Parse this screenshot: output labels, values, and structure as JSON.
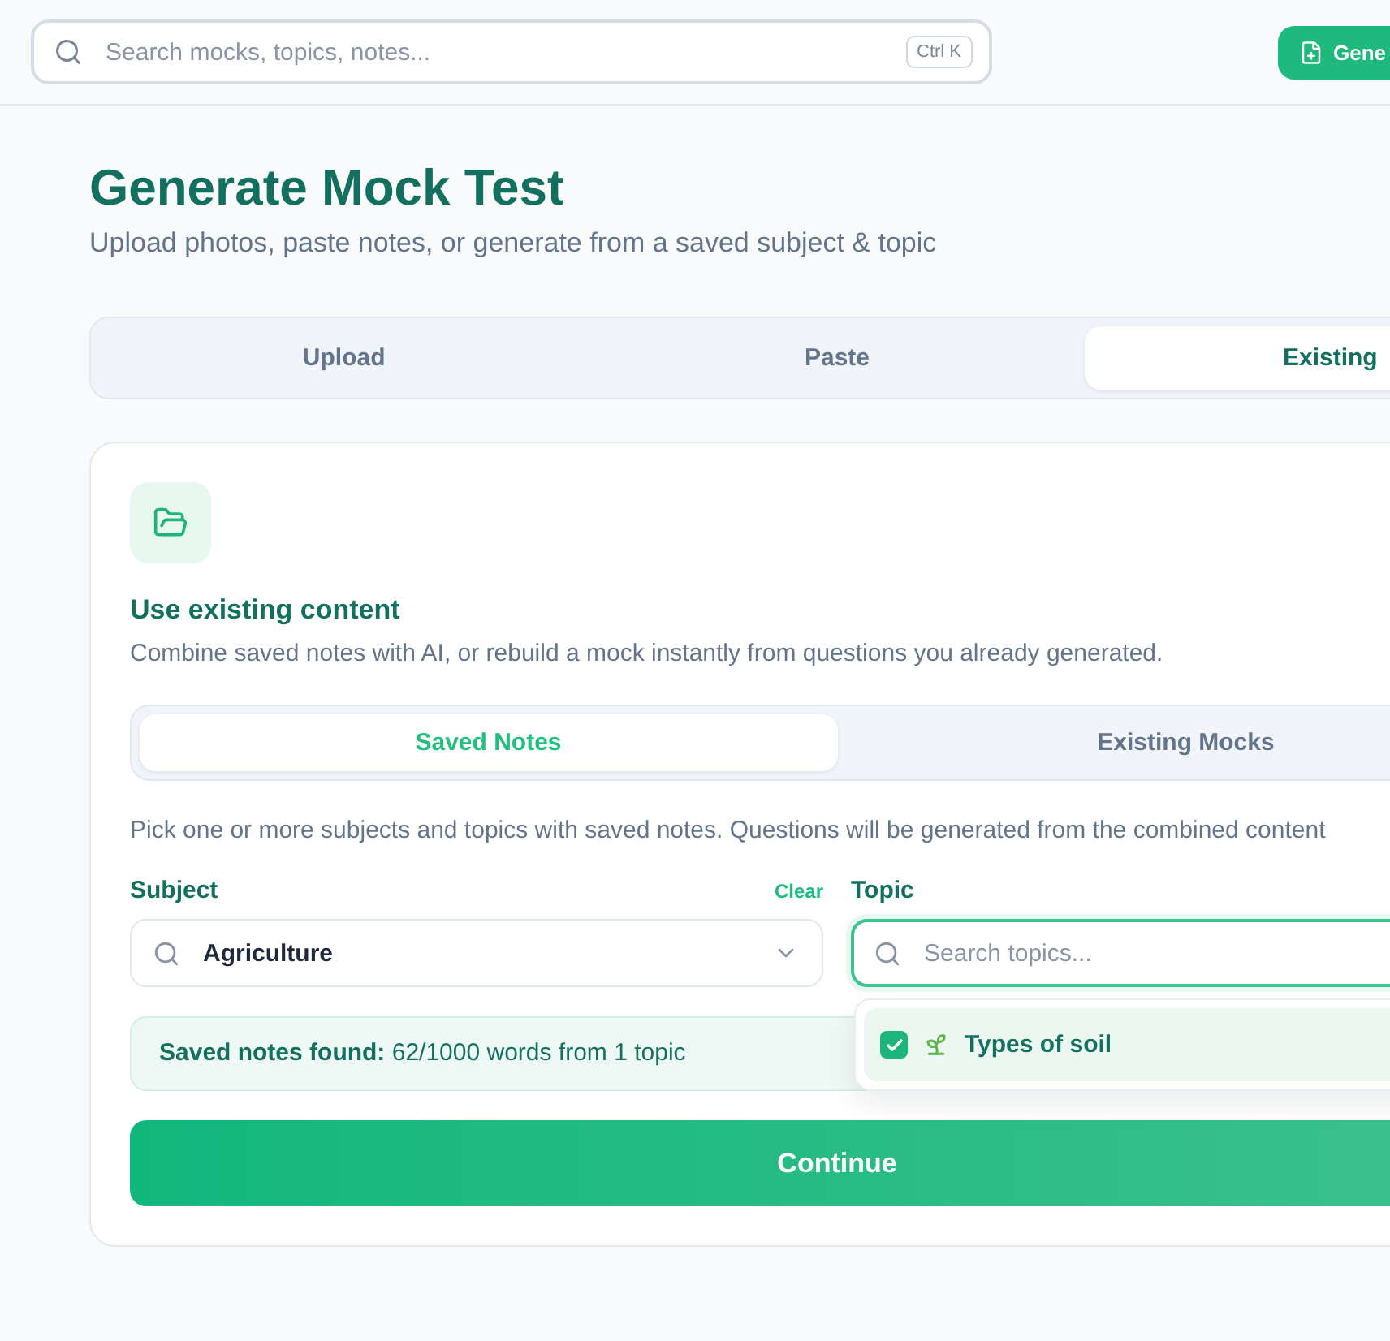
{
  "top_bar": {
    "search": {
      "placeholder": "Search mocks, topics, notes...",
      "shortcut": "Ctrl K"
    },
    "button": {
      "label": "Gene"
    }
  },
  "header": {
    "title": "Generate Mock Test",
    "subtitle": "Upload photos, paste notes, or generate from a saved subject & topic"
  },
  "mode_tabs": [
    {
      "label": "Upload",
      "selected": false
    },
    {
      "label": "Paste",
      "selected": false
    },
    {
      "label": "Existing",
      "selected": true
    }
  ],
  "card": {
    "title": "Use existing content",
    "description": "Combine saved notes with AI, or rebuild a mock instantly from questions you already generated.",
    "source_tabs": [
      {
        "label": "Saved Notes",
        "selected": true
      },
      {
        "label": "Existing Mocks",
        "selected": false
      }
    ],
    "instructions": "Pick one or more subjects and topics with saved notes. Questions will be generated from the combined content",
    "subject": {
      "label": "Subject",
      "clear": "Clear",
      "value": "Agriculture"
    },
    "topic": {
      "label": "Topic",
      "placeholder": "Search topics...",
      "focused": true,
      "expanded": true,
      "options": [
        {
          "label": "Types of soil",
          "checked": true
        }
      ]
    },
    "summary": "**Saved notes found:** 62/1000 words from 1 topic",
    "continue": "Continue"
  }
}
